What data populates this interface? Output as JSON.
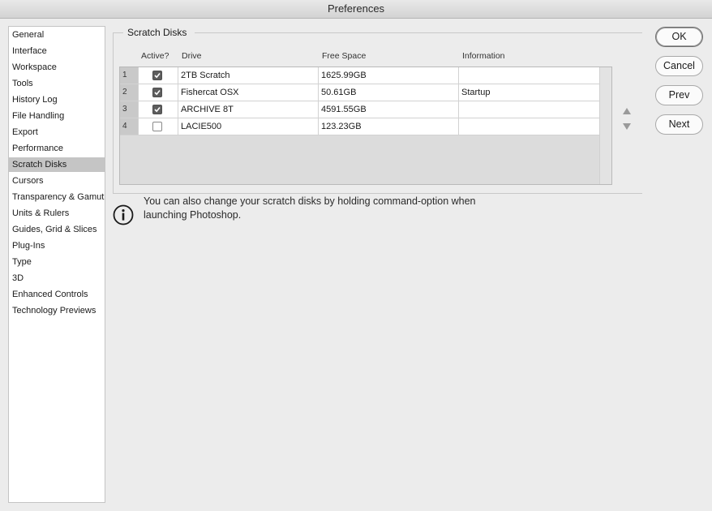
{
  "window": {
    "title": "Preferences"
  },
  "sidebar": {
    "items": [
      {
        "label": "General"
      },
      {
        "label": "Interface"
      },
      {
        "label": "Workspace"
      },
      {
        "label": "Tools"
      },
      {
        "label": "History Log"
      },
      {
        "label": "File Handling"
      },
      {
        "label": "Export"
      },
      {
        "label": "Performance"
      },
      {
        "label": "Scratch Disks",
        "selected": true
      },
      {
        "label": "Cursors"
      },
      {
        "label": "Transparency & Gamut"
      },
      {
        "label": "Units & Rulers"
      },
      {
        "label": "Guides, Grid & Slices"
      },
      {
        "label": "Plug-Ins"
      },
      {
        "label": "Type"
      },
      {
        "label": "3D"
      },
      {
        "label": "Enhanced Controls"
      },
      {
        "label": "Technology Previews"
      }
    ]
  },
  "scratch_disks": {
    "title": "Scratch Disks",
    "columns": {
      "active": "Active?",
      "drive": "Drive",
      "free_space": "Free Space",
      "information": "Information"
    },
    "rows": [
      {
        "num": "1",
        "active": true,
        "drive": "2TB Scratch",
        "free_space": "1625.99GB",
        "information": ""
      },
      {
        "num": "2",
        "active": true,
        "drive": "Fishercat OSX",
        "free_space": "50.61GB",
        "information": "Startup"
      },
      {
        "num": "3",
        "active": true,
        "drive": "ARCHIVE 8T",
        "free_space": "4591.55GB",
        "information": ""
      },
      {
        "num": "4",
        "active": false,
        "drive": "LACIE500",
        "free_space": "123.23GB",
        "information": ""
      }
    ],
    "move_up_icon": "triangle-up-icon",
    "move_down_icon": "triangle-down-icon"
  },
  "info": {
    "icon": "info-icon",
    "text": "You can also change your scratch disks by holding command-option when launching Photoshop."
  },
  "buttons": {
    "ok": "OK",
    "cancel": "Cancel",
    "prev": "Prev",
    "next": "Next"
  }
}
